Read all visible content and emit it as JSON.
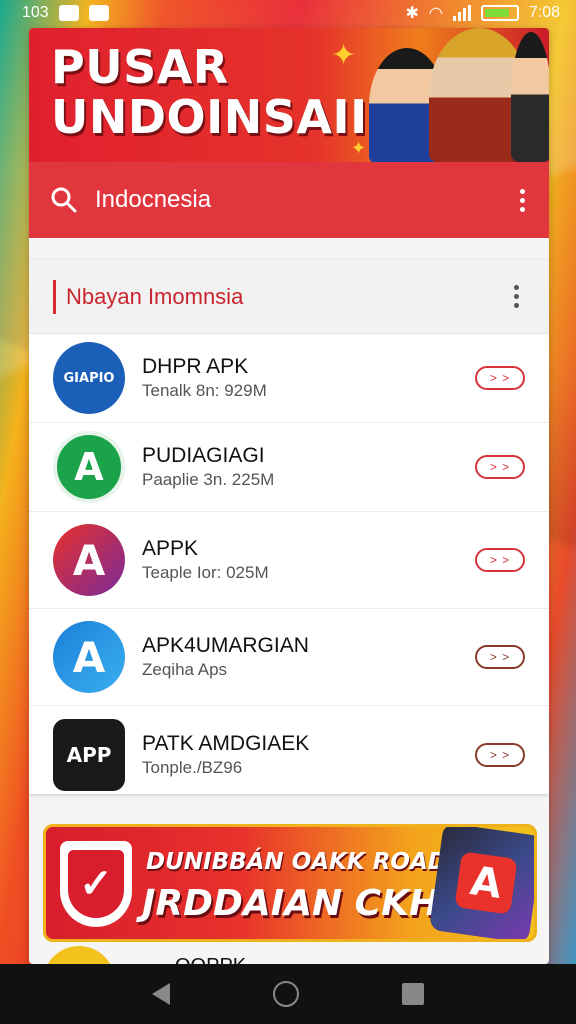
{
  "status_bar": {
    "time_left": "103",
    "time_right": "7:08"
  },
  "hero": {
    "title_line1": "PUSAR",
    "title_line2": "UNDOINSAII"
  },
  "search": {
    "query": "Indocnesia"
  },
  "section": {
    "title": "Nbayan Imomnsia"
  },
  "apps": [
    {
      "name": "DHPR APK",
      "subtitle": "Tenalk 8n: 929M",
      "icon_label": "GIAPIO",
      "icon_color": "#1b5fb8",
      "button": "> >"
    },
    {
      "name": "PUDIAGIAGI",
      "subtitle": "Paaplie 3n. 225M",
      "icon_label": "A",
      "icon_color": "#1aa34a",
      "button": "> >"
    },
    {
      "name": "APPK",
      "subtitle": "Teaple Ior: 025M",
      "icon_label": "A",
      "icon_color": "#d8283a",
      "button": "> >"
    },
    {
      "name": "APK4UMARGIAN",
      "subtitle": "Zeqiha Aps",
      "icon_label": "A",
      "icon_color": "#1b7fd8",
      "button": "> >"
    },
    {
      "name": "PATK AMDGIAEK",
      "subtitle": "Tonple./BZ96",
      "icon_label": "APP",
      "icon_color": "#1a1a1a",
      "button": "> >"
    }
  ],
  "promo": {
    "line1": "DUNIBBÁN OAKK ROADAGGA",
    "line2": "JRDDAIAN CKHOK",
    "phone_icon": "A"
  },
  "peek": {
    "label": "OOPPK"
  },
  "colors": {
    "accent": "#e2363f",
    "header_red": "#c8252e"
  }
}
